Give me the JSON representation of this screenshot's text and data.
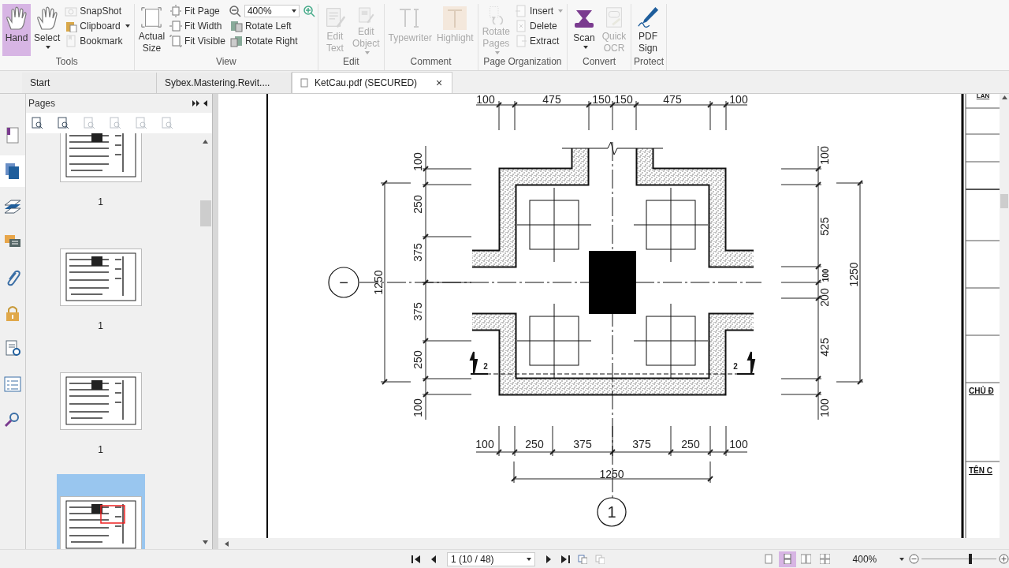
{
  "ribbon": {
    "groups": [
      {
        "label": "Tools",
        "items": [
          {
            "kind": "large",
            "label": "Hand",
            "selected": true,
            "disabled": false,
            "dropdown": false
          },
          {
            "kind": "large",
            "label": "Select",
            "selected": false,
            "disabled": false,
            "dropdown": true
          },
          {
            "kind": "small",
            "label": "SnapShot",
            "selected": false,
            "disabled": true,
            "dropdown": false
          },
          {
            "kind": "small",
            "label": "Clipboard",
            "selected": false,
            "disabled": false,
            "dropdown": true
          },
          {
            "kind": "small",
            "label": "Bookmark",
            "selected": false,
            "disabled": true,
            "dropdown": false
          }
        ]
      },
      {
        "label": "View",
        "items": [
          {
            "kind": "large",
            "label": "Actual Size",
            "selected": false,
            "disabled": false,
            "dropdown": false
          },
          {
            "kind": "small",
            "label": "Fit Page",
            "selected": false,
            "disabled": false,
            "dropdown": false
          },
          {
            "kind": "small",
            "label": "Fit Width",
            "selected": false,
            "disabled": false,
            "dropdown": false
          },
          {
            "kind": "small",
            "label": "Fit Visible",
            "selected": false,
            "disabled": false,
            "dropdown": false
          },
          {
            "kind": "zoom",
            "value": "400%"
          },
          {
            "kind": "small",
            "label": "Rotate Left",
            "selected": false,
            "disabled": false,
            "dropdown": false
          },
          {
            "kind": "small",
            "label": "Rotate Right",
            "selected": false,
            "disabled": false,
            "dropdown": false
          }
        ]
      },
      {
        "label": "Edit",
        "items": [
          {
            "kind": "large",
            "label": "Edit Text",
            "selected": false,
            "disabled": true,
            "dropdown": false
          },
          {
            "kind": "large",
            "label": "Edit Object",
            "selected": false,
            "disabled": true,
            "dropdown": true
          }
        ]
      },
      {
        "label": "Comment",
        "items": [
          {
            "kind": "large",
            "label": "Typewriter",
            "selected": false,
            "disabled": true,
            "dropdown": false
          },
          {
            "kind": "large",
            "label": "Highlight",
            "selected": false,
            "disabled": true,
            "dropdown": false
          }
        ]
      },
      {
        "label": "Page Organization",
        "items": [
          {
            "kind": "large",
            "label": "Rotate Pages",
            "selected": false,
            "disabled": true,
            "dropdown": true
          },
          {
            "kind": "small",
            "label": "Insert",
            "selected": false,
            "disabled": true,
            "dropdown": true
          },
          {
            "kind": "small",
            "label": "Delete",
            "selected": false,
            "disabled": true,
            "dropdown": false
          },
          {
            "kind": "small",
            "label": "Extract",
            "selected": false,
            "disabled": true,
            "dropdown": false
          }
        ]
      },
      {
        "label": "Convert",
        "items": [
          {
            "kind": "large",
            "label": "Scan",
            "selected": false,
            "disabled": false,
            "dropdown": true
          },
          {
            "kind": "large",
            "label": "Quick OCR",
            "selected": false,
            "disabled": true,
            "dropdown": false
          }
        ]
      },
      {
        "label": "Protect",
        "items": [
          {
            "kind": "large",
            "label": "PDF Sign",
            "selected": false,
            "disabled": false,
            "dropdown": false
          }
        ]
      }
    ]
  },
  "tabs": [
    {
      "label": "Start",
      "selected": false
    },
    {
      "label": "Sybex.Mastering.Revit....",
      "selected": false
    },
    {
      "label": "KetCau.pdf (SECURED)",
      "selected": true,
      "close": "×"
    }
  ],
  "side_icons": [
    {
      "selected": false
    },
    {
      "selected": true
    },
    {
      "selected": false
    },
    {
      "selected": false
    },
    {
      "selected": false
    },
    {
      "selected": false
    },
    {
      "selected": false
    },
    {
      "selected": false
    },
    {
      "selected": false
    }
  ],
  "pages_panel": {
    "title": "Pages",
    "tools": [
      {
        "disabled": false
      },
      {
        "disabled": false
      },
      {
        "disabled": true
      },
      {
        "disabled": true
      },
      {
        "disabled": true
      },
      {
        "disabled": true
      }
    ],
    "thumbnails": [
      {
        "label": "1",
        "selected": false
      },
      {
        "label": "1",
        "selected": false
      },
      {
        "label": "1",
        "selected": false
      },
      {
        "selected": true
      }
    ]
  },
  "drawing": {
    "top_dimensions": [
      "100",
      "475",
      "150",
      "150",
      "475",
      "100"
    ],
    "left_dimensions": [
      "100",
      "250",
      "375",
      "375",
      "250",
      "100"
    ],
    "left_total": "1250",
    "right_dimensions": [
      "100",
      "525",
      "100",
      "200",
      "425",
      "100"
    ],
    "right_total": "1250",
    "bottom_dimensions": [
      "100",
      "250",
      "375",
      "375",
      "250",
      "100"
    ],
    "bottom_total": "1250",
    "axis_markers": [
      "−",
      "1"
    ],
    "section_markers": [
      "2",
      "2"
    ],
    "title_block": [
      "LAN",
      "CHỦ Đ",
      "TÊN C"
    ]
  },
  "status_bar": {
    "page": "1 (10 / 48)",
    "view_modes": [
      {
        "selected": false
      },
      {
        "selected": true
      },
      {
        "selected": false
      },
      {
        "selected": false
      }
    ],
    "zoom": "400%",
    "level": 0.65
  }
}
